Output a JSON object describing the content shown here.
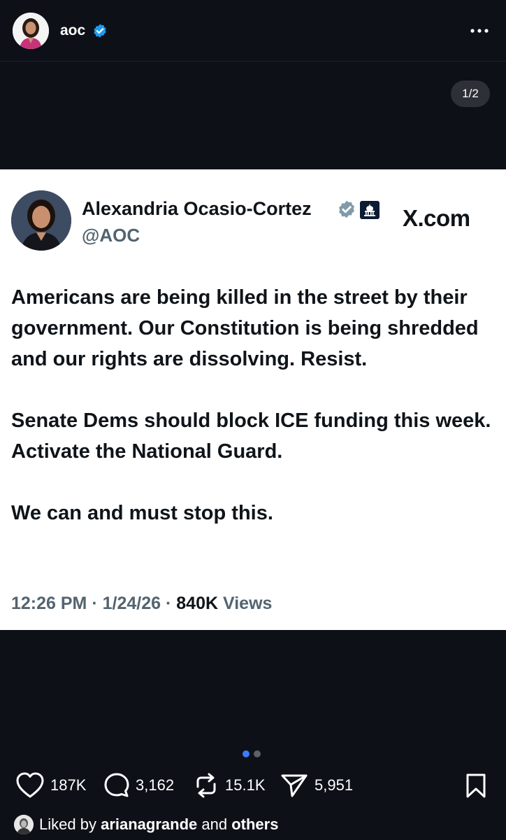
{
  "header": {
    "username": "aoc",
    "more_icon": "more-horizontal-icon"
  },
  "carousel": {
    "counter": "1/2",
    "active_index": 0,
    "dot_colors": {
      "active": "#3a7bff",
      "inactive": "#5c6068"
    }
  },
  "tweet": {
    "name": "Alexandria Ocasio-Cortez",
    "handle": "@AOC",
    "source": "X.com",
    "paragraphs": [
      "Americans are being killed in the street by their government. Our Constitution is being shredded and our rights are dissolving. Resist.",
      "Senate Dems should block ICE funding this week. Activate the National Guard.",
      "We can and must stop this."
    ],
    "time": "12:26 PM",
    "separator": "·",
    "date": "1/24/26",
    "views_count": "840K",
    "views_label": "Views"
  },
  "actions": {
    "likes": "187K",
    "comments": "3,162",
    "reposts": "15.1K",
    "shares": "5,951"
  },
  "liked_by": {
    "prefix": "Liked by",
    "user": "arianagrande",
    "and": "and",
    "others": "others"
  },
  "colors": {
    "background": "#0d1017",
    "verified_blue": "#1d9bf0",
    "tweet_text": "#0f1419",
    "tweet_secondary": "#536471"
  }
}
